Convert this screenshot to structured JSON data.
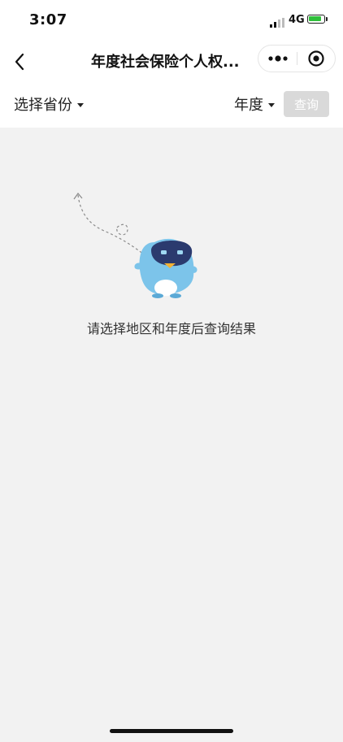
{
  "status_bar": {
    "time": "3:07",
    "network": "4G"
  },
  "nav": {
    "title": "年度社会保险个人权..."
  },
  "filters": {
    "province_label": "选择省份",
    "year_label": "年度",
    "query_button": "查询"
  },
  "empty_state": {
    "message": "请选择地区和年度后查询结果"
  },
  "icons": {
    "back": "back-chevron-icon",
    "more": "more-dots-icon",
    "close": "target-close-icon",
    "signal": "signal-bars-icon",
    "battery": "battery-charging-icon"
  },
  "colors": {
    "background": "#f2f2f2",
    "header": "#ffffff",
    "query_button_disabled": "#d9d9d9",
    "mascot": "#7cc4ea",
    "battery": "#2fbf3a"
  }
}
